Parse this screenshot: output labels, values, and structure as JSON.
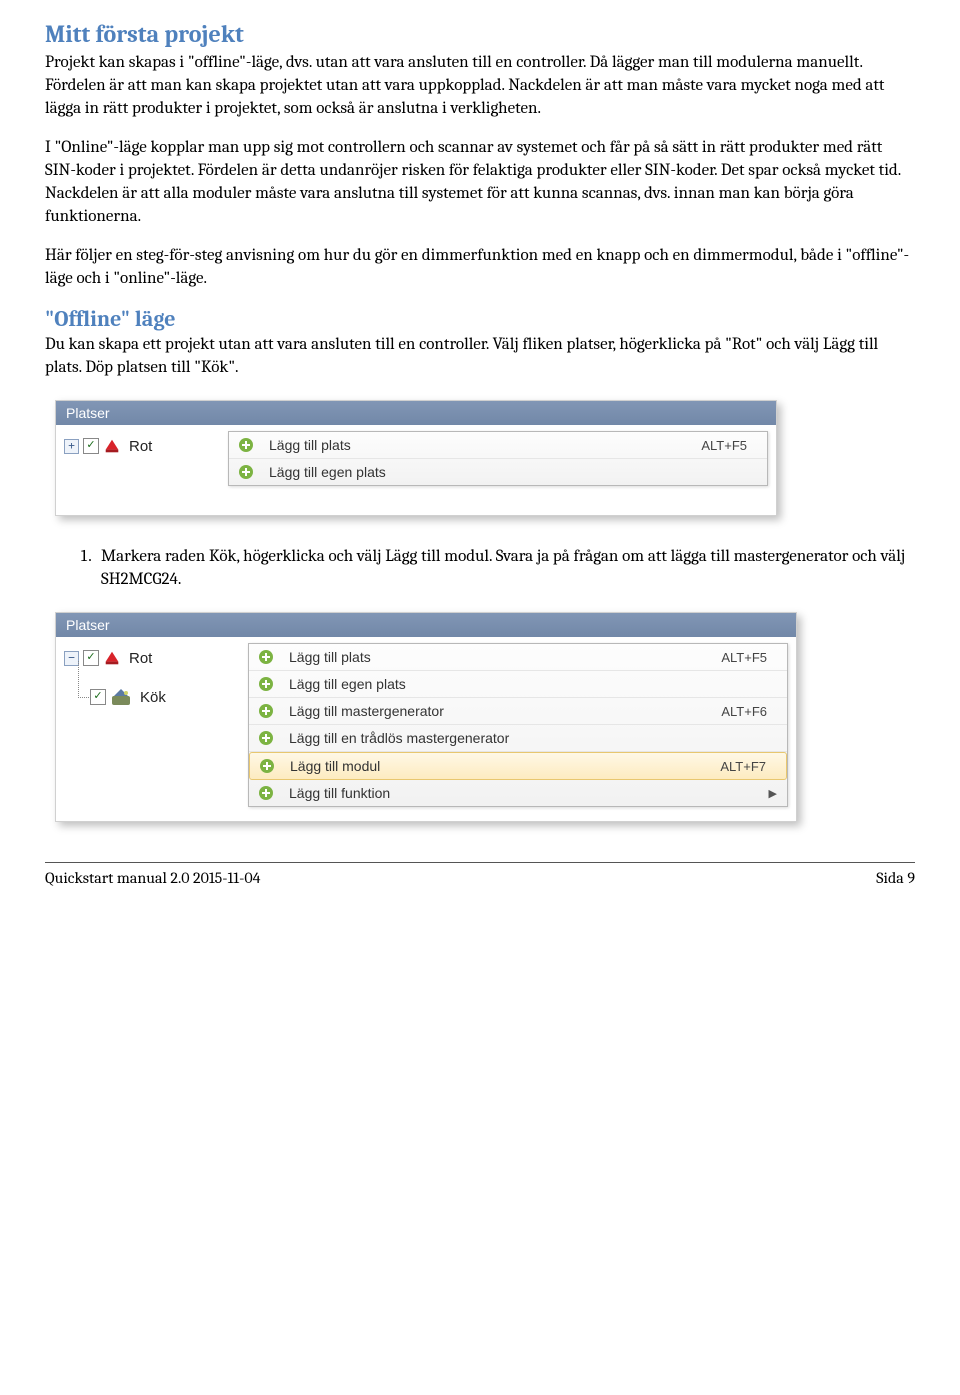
{
  "heading1": "Mitt första projekt",
  "para1": "Projekt kan skapas i \"offline\"-läge, dvs. utan att vara ansluten till en controller. Då lägger man till modulerna manuellt. Fördelen är att man kan skapa projektet utan att vara uppkopplad. Nackdelen är att man måste vara mycket noga med att lägga in rätt produkter i projektet, som också är anslutna i verkligheten.",
  "para2": "I \"Online\"-läge kopplar man upp sig mot controllern och scannar av systemet och får på så sätt in rätt produkter med rätt SIN-koder i projektet. Fördelen är detta undanröjer risken för felaktiga produkter eller SIN-koder. Det spar också mycket tid. Nackdelen är att alla moduler måste vara anslutna till systemet för att kunna scannas, dvs. innan man kan börja göra funktionerna.",
  "para3": "Här följer en steg-för-steg anvisning om hur du gör en dimmerfunktion med en knapp och en dimmermodul, både i \"offline\"-läge och i \"online\"-läge.",
  "heading2": "\"Offline\" läge",
  "para4": "Du kan skapa ett projekt utan att vara ansluten till en controller. Välj fliken platser, högerklicka på \"Rot\" och välj Lägg till plats. Döp platsen till \"Kök\".",
  "shot1": {
    "title": "Platser",
    "root": "Rot",
    "menu": [
      {
        "label": "Lägg till plats",
        "shortcut": "ALT+F5"
      },
      {
        "label": "Lägg till egen plats",
        "shortcut": ""
      }
    ]
  },
  "step1": "Markera raden Kök, högerklicka och välj Lägg till modul. Svara ja på frågan om att lägga till mastergenerator och välj SH2MCG24.",
  "shot2": {
    "title": "Platser",
    "root": "Rot",
    "child": "Kök",
    "menu": [
      {
        "label": "Lägg till plats",
        "shortcut": "ALT+F5",
        "hl": false
      },
      {
        "label": "Lägg till egen plats",
        "shortcut": "",
        "hl": false
      },
      {
        "label": "Lägg till mastergenerator",
        "shortcut": "ALT+F6",
        "hl": false
      },
      {
        "label": "Lägg till en trådlös mastergenerator",
        "shortcut": "",
        "hl": false
      },
      {
        "label": "Lägg till modul",
        "shortcut": "ALT+F7",
        "hl": true
      },
      {
        "label": "Lägg till funktion",
        "shortcut": "",
        "hl": false,
        "arrow": true
      }
    ]
  },
  "footer_left": "Quickstart manual 2.0 2015-11-04",
  "footer_right": "Sida 9"
}
